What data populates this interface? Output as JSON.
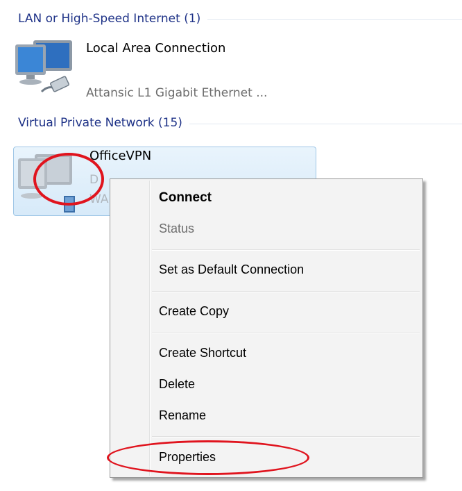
{
  "groups": [
    {
      "label": "LAN or High-Speed Internet (1)"
    },
    {
      "label": "Virtual Private Network (15)"
    }
  ],
  "lan_connection": {
    "name": "Local Area Connection",
    "adapter": "Attansic L1 Gigabit Ethernet ..."
  },
  "vpn_connection": {
    "name": "OfficeVPN",
    "status_partial": "D",
    "device_partial": "WA"
  },
  "context_menu": {
    "items": [
      {
        "label": "Connect",
        "style": "bold"
      },
      {
        "label": "Status",
        "style": "disabled"
      },
      {
        "label": "Set as Default Connection"
      },
      {
        "label": "Create Copy"
      },
      {
        "label": "Create Shortcut"
      },
      {
        "label": "Delete"
      },
      {
        "label": "Rename"
      },
      {
        "label": "Properties"
      }
    ]
  },
  "annotation_color": "#e0141e",
  "icons": [
    "network-computer-icon",
    "ethernet-cable-icon",
    "vpn-computer-icon",
    "vpn-device-icon"
  ]
}
